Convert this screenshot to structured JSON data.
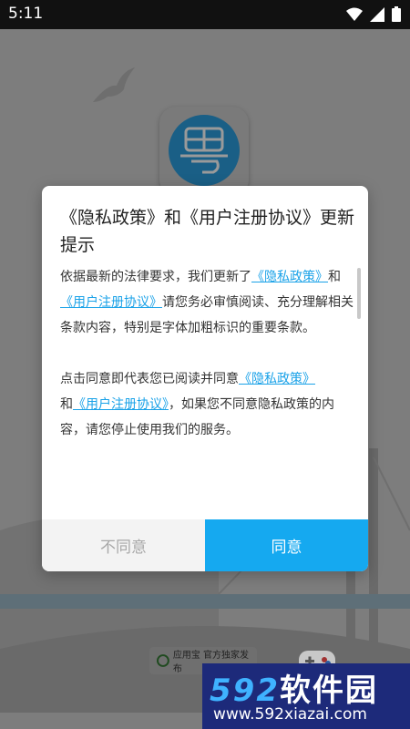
{
  "status_bar": {
    "time": "5:11"
  },
  "publisher_badge": {
    "text": "应用宝 官方独家发布"
  },
  "dialog": {
    "title": "《隐私政策》和《用户注册协议》更新提示",
    "p1_prefix": "依据最新的法律要求，我们更新了",
    "privacy_link": "《隐私政策》",
    "and": "和",
    "terms_link": "《用户注册协议》",
    "p1_suffix": "请您务必审慎阅读、充分理解相关条款内容，特别是字体加粗标识的重要条款。",
    "p2_prefix": " 点击同意即代表您已阅读并同意",
    "p2_suffix": "，如果您不同意隐私政策的内容，请您停止使用我们的服务。",
    "disagree_label": "不同意",
    "agree_label": "同意"
  },
  "watermark": {
    "brand_num": "592",
    "brand_text": "软件园",
    "url": "www.592xiazai.com"
  }
}
